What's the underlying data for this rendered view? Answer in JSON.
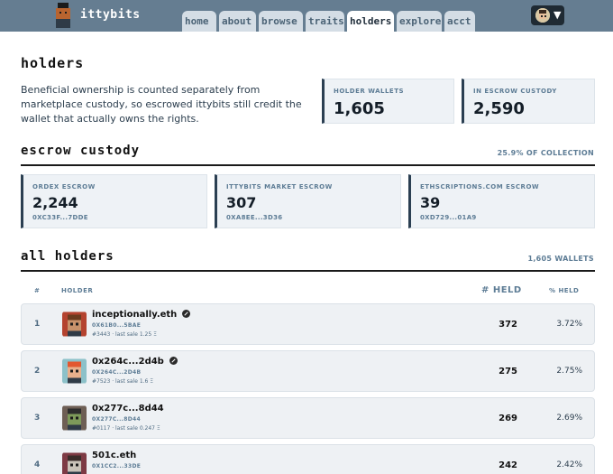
{
  "header": {
    "brand": "ittybits",
    "tabs": [
      {
        "label": "home",
        "active": false
      },
      {
        "label": "about",
        "active": false
      },
      {
        "label": "browse",
        "active": false
      },
      {
        "label": "traits",
        "active": false
      },
      {
        "label": "holders",
        "active": true
      },
      {
        "label": "explore",
        "active": false
      },
      {
        "label": "acct",
        "active": false
      }
    ],
    "account_icon": "chevron-down-icon",
    "colors": {
      "bar": "#657d91",
      "tab": "#d4dde5",
      "tab_active": "#ffffff"
    }
  },
  "page": {
    "title": "holders",
    "intro": "Beneficial ownership is counted separately from marketplace custody, so escrowed ittybits still credit the wallet that actually owns the rights."
  },
  "stats": [
    {
      "label": "HOLDER WALLETS",
      "value": "1,605"
    },
    {
      "label": "IN ESCROW CUSTODY",
      "value": "2,590"
    }
  ],
  "escrow": {
    "title": "escrow custody",
    "meta": "25.9% OF COLLECTION",
    "cards": [
      {
        "label": "ORDEX ESCROW",
        "value": "2,244",
        "address": "0XC33F...7DDE"
      },
      {
        "label": "ITTYBITS MARKET ESCROW",
        "value": "307",
        "address": "0XA8EE...3D36"
      },
      {
        "label": "ETHSCRIPTIONS.COM ESCROW",
        "value": "39",
        "address": "0XD729...01A9"
      }
    ]
  },
  "holders": {
    "title": "all holders",
    "meta": "1,605 WALLETS",
    "columns": {
      "rank": "#",
      "holder": "HOLDER",
      "held": "# HELD",
      "pct": "% HELD"
    },
    "rows": [
      {
        "rank": "1",
        "name": "inceptionally.eth",
        "verified": true,
        "address": "0X61B0...5BAE",
        "sale": "#3443 · last sale 1.25 Ξ",
        "held": "372",
        "pct": "3.72%",
        "skin": "#c7926b",
        "hair": "#6b3b1f",
        "bg": "#b4432f"
      },
      {
        "rank": "2",
        "name": "0x264c...2d4b",
        "verified": true,
        "address": "0X264C...2D4B",
        "sale": "#7523 · last sale 1.6 Ξ",
        "held": "275",
        "pct": "2.75%",
        "skin": "#e8b08c",
        "hair": "#e2572f",
        "bg": "#8cc1c9"
      },
      {
        "rank": "3",
        "name": "0x277c...8d44",
        "verified": false,
        "address": "0X277C...8D44",
        "sale": "#0117 · last sale 0.247 Ξ",
        "held": "269",
        "pct": "2.69%",
        "skin": "#7d9a5a",
        "hair": "#2d2d2d",
        "bg": "#6e5f55"
      },
      {
        "rank": "4",
        "name": "501c.eth",
        "verified": false,
        "address": "0X1CC2...33DE",
        "sale": "",
        "held": "242",
        "pct": "2.42%",
        "skin": "#c9c2b8",
        "hair": "#3a2c2a",
        "bg": "#7d3a44"
      }
    ]
  }
}
